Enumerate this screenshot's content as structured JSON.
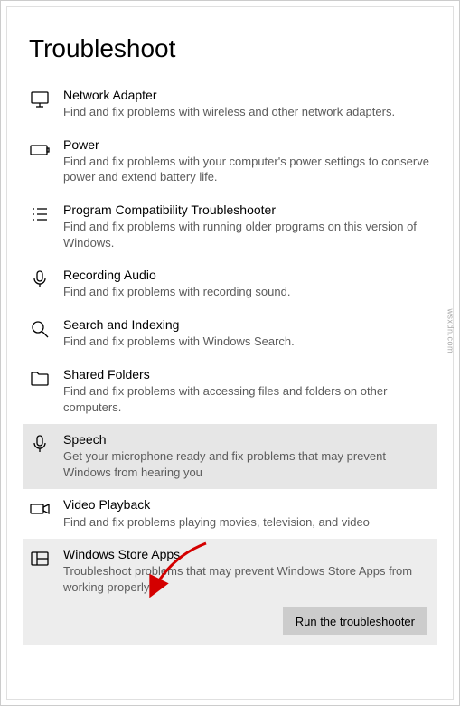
{
  "page": {
    "title": "Troubleshoot"
  },
  "items": [
    {
      "title": "Network Adapter",
      "desc": "Find and fix problems with wireless and other network adapters."
    },
    {
      "title": "Power",
      "desc": "Find and fix problems with your computer's power settings to conserve power and extend battery life."
    },
    {
      "title": "Program Compatibility Troubleshooter",
      "desc": "Find and fix problems with running older programs on this version of Windows."
    },
    {
      "title": "Recording Audio",
      "desc": "Find and fix problems with recording sound."
    },
    {
      "title": "Search and Indexing",
      "desc": "Find and fix problems with Windows Search."
    },
    {
      "title": "Shared Folders",
      "desc": "Find and fix problems with accessing files and folders on other computers."
    },
    {
      "title": "Speech",
      "desc": "Get your microphone ready and fix problems that may prevent Windows from hearing you"
    },
    {
      "title": "Video Playback",
      "desc": "Find and fix problems playing movies, television, and video"
    },
    {
      "title": "Windows Store Apps",
      "desc": "Troubleshoot problems that may prevent Windows Store Apps from working properly"
    }
  ],
  "button": {
    "run": "Run the troubleshooter"
  },
  "watermark": {
    "side": "wsxdn.com"
  }
}
